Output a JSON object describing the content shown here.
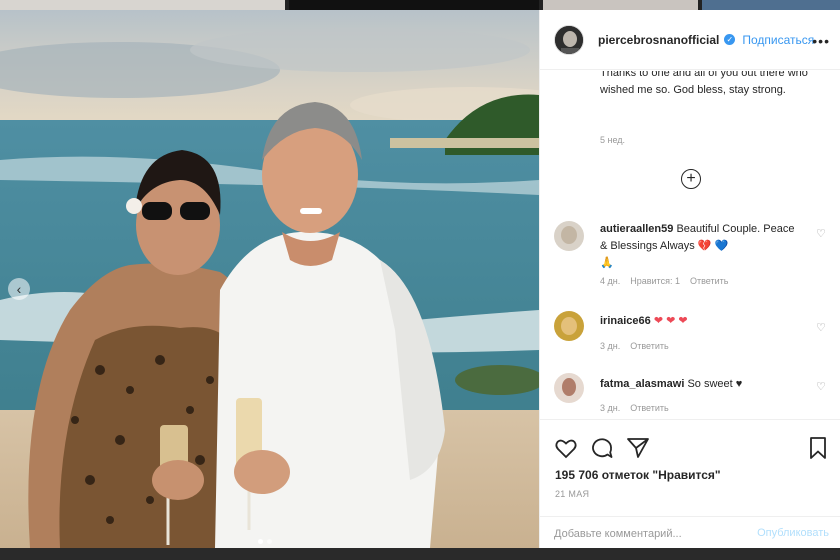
{
  "post": {
    "username": "piercebrosnanofficial",
    "verified_icon": "verified-badge-icon",
    "follow_label": "Подписаться",
    "more_icon": "more-options-icon",
    "caption_text": "Thanks to one and all of you out there who wished me so. God bless, stay strong.",
    "caption_time": "5 нед."
  },
  "comments": [
    {
      "username": "autieraallen59",
      "text": "Beautiful Couple. Peace & Blessings Always",
      "emoji": [
        "heart-broken-red-icon",
        "heart-blue-icon",
        "praying-hands-icon"
      ],
      "time": "4 дн.",
      "likes": "Нравится: 1",
      "reply": "Ответить"
    },
    {
      "username": "irinaice66",
      "text": "",
      "emoji": [
        "heart-red-icon",
        "heart-red-icon",
        "heart-red-icon"
      ],
      "time": "3 дн.",
      "reply": "Ответить"
    },
    {
      "username": "fatma_alasmawi",
      "text": "So sweet ♥",
      "time": "3 дн.",
      "reply": "Ответить"
    }
  ],
  "actions": {
    "likes_count": "195 706 отметок \"Нравится\"",
    "date": "21 МАЯ",
    "comment_placeholder": "Добавьте комментарий...",
    "publish_label": "Опубликовать"
  },
  "carousel": {
    "slides": 2,
    "active_slide": 1
  },
  "colors": {
    "accent": "#3897f0",
    "like_red": "#ed4956",
    "text": "#262626",
    "muted": "#999999"
  }
}
